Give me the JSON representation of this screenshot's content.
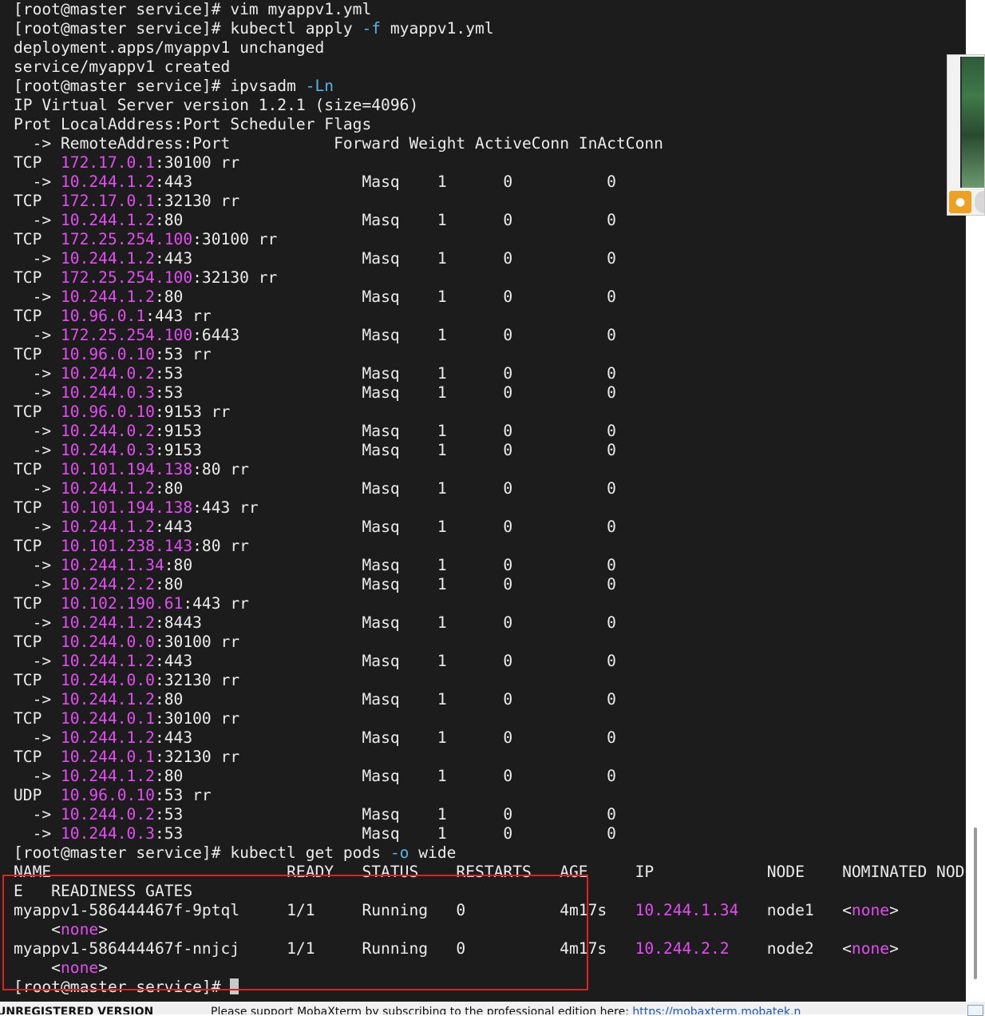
{
  "terminal": {
    "colors": {
      "background": "#1c1c1c",
      "text": "#ececec",
      "ip": "#e34df2",
      "flag": "#56b6e6",
      "highlight_box": "#dd2222"
    },
    "lines": [
      [
        {
          "t": "[root@master service]# vim myappv1.yml",
          "c": "n"
        }
      ],
      [
        {
          "t": "[root@master service]# kubectl apply ",
          "c": "n"
        },
        {
          "t": "-f",
          "c": "c"
        },
        {
          "t": " myappv1.yml",
          "c": "n"
        }
      ],
      [
        {
          "t": "deployment.apps/myappv1 unchanged",
          "c": "n"
        }
      ],
      [
        {
          "t": "service/myappv1 created",
          "c": "n"
        }
      ],
      [
        {
          "t": "[root@master service]# ipvsadm ",
          "c": "n"
        },
        {
          "t": "-Ln",
          "c": "c"
        }
      ],
      [
        {
          "t": "IP Virtual Server version 1.2.1 (size=4096)",
          "c": "n"
        }
      ],
      [
        {
          "t": "Prot LocalAddress:Port Scheduler Flags",
          "c": "n"
        }
      ],
      [
        {
          "t": "  -> RemoteAddress:Port           Forward Weight ActiveConn InActConn",
          "c": "n"
        }
      ],
      [
        {
          "t": "TCP  ",
          "c": "n"
        },
        {
          "t": "172.17.0.1",
          "c": "m"
        },
        {
          "t": ":30100 rr",
          "c": "n"
        }
      ],
      [
        {
          "t": "  -> ",
          "c": "n"
        },
        {
          "t": "10.244.1.2",
          "c": "m"
        },
        {
          "t": ":443                  Masq    1      0          0",
          "c": "n"
        }
      ],
      [
        {
          "t": "TCP  ",
          "c": "n"
        },
        {
          "t": "172.17.0.1",
          "c": "m"
        },
        {
          "t": ":32130 rr",
          "c": "n"
        }
      ],
      [
        {
          "t": "  -> ",
          "c": "n"
        },
        {
          "t": "10.244.1.2",
          "c": "m"
        },
        {
          "t": ":80                   Masq    1      0          0",
          "c": "n"
        }
      ],
      [
        {
          "t": "TCP  ",
          "c": "n"
        },
        {
          "t": "172.25.254.100",
          "c": "m"
        },
        {
          "t": ":30100 rr",
          "c": "n"
        }
      ],
      [
        {
          "t": "  -> ",
          "c": "n"
        },
        {
          "t": "10.244.1.2",
          "c": "m"
        },
        {
          "t": ":443                  Masq    1      0          0",
          "c": "n"
        }
      ],
      [
        {
          "t": "TCP  ",
          "c": "n"
        },
        {
          "t": "172.25.254.100",
          "c": "m"
        },
        {
          "t": ":32130 rr",
          "c": "n"
        }
      ],
      [
        {
          "t": "  -> ",
          "c": "n"
        },
        {
          "t": "10.244.1.2",
          "c": "m"
        },
        {
          "t": ":80                   Masq    1      0          0",
          "c": "n"
        }
      ],
      [
        {
          "t": "TCP  ",
          "c": "n"
        },
        {
          "t": "10.96.0.1",
          "c": "m"
        },
        {
          "t": ":443 rr",
          "c": "n"
        }
      ],
      [
        {
          "t": "  -> ",
          "c": "n"
        },
        {
          "t": "172.25.254.100",
          "c": "m"
        },
        {
          "t": ":6443             Masq    1      0          0",
          "c": "n"
        }
      ],
      [
        {
          "t": "TCP  ",
          "c": "n"
        },
        {
          "t": "10.96.0.10",
          "c": "m"
        },
        {
          "t": ":53 rr",
          "c": "n"
        }
      ],
      [
        {
          "t": "  -> ",
          "c": "n"
        },
        {
          "t": "10.244.0.2",
          "c": "m"
        },
        {
          "t": ":53                   Masq    1      0          0",
          "c": "n"
        }
      ],
      [
        {
          "t": "  -> ",
          "c": "n"
        },
        {
          "t": "10.244.0.3",
          "c": "m"
        },
        {
          "t": ":53                   Masq    1      0          0",
          "c": "n"
        }
      ],
      [
        {
          "t": "TCP  ",
          "c": "n"
        },
        {
          "t": "10.96.0.10",
          "c": "m"
        },
        {
          "t": ":9153 rr",
          "c": "n"
        }
      ],
      [
        {
          "t": "  -> ",
          "c": "n"
        },
        {
          "t": "10.244.0.2",
          "c": "m"
        },
        {
          "t": ":9153                 Masq    1      0          0",
          "c": "n"
        }
      ],
      [
        {
          "t": "  -> ",
          "c": "n"
        },
        {
          "t": "10.244.0.3",
          "c": "m"
        },
        {
          "t": ":9153                 Masq    1      0          0",
          "c": "n"
        }
      ],
      [
        {
          "t": "TCP  ",
          "c": "n"
        },
        {
          "t": "10.101.194.138",
          "c": "m"
        },
        {
          "t": ":80 rr",
          "c": "n"
        }
      ],
      [
        {
          "t": "  -> ",
          "c": "n"
        },
        {
          "t": "10.244.1.2",
          "c": "m"
        },
        {
          "t": ":80                   Masq    1      0          0",
          "c": "n"
        }
      ],
      [
        {
          "t": "TCP  ",
          "c": "n"
        },
        {
          "t": "10.101.194.138",
          "c": "m"
        },
        {
          "t": ":443 rr",
          "c": "n"
        }
      ],
      [
        {
          "t": "  -> ",
          "c": "n"
        },
        {
          "t": "10.244.1.2",
          "c": "m"
        },
        {
          "t": ":443                  Masq    1      0          0",
          "c": "n"
        }
      ],
      [
        {
          "t": "TCP  ",
          "c": "n"
        },
        {
          "t": "10.101.238.143",
          "c": "m"
        },
        {
          "t": ":80 rr",
          "c": "n"
        }
      ],
      [
        {
          "t": "  -> ",
          "c": "n"
        },
        {
          "t": "10.244.1.34",
          "c": "m"
        },
        {
          "t": ":80                  Masq    1      0          0",
          "c": "n"
        }
      ],
      [
        {
          "t": "  -> ",
          "c": "n"
        },
        {
          "t": "10.244.2.2",
          "c": "m"
        },
        {
          "t": ":80                   Masq    1      0          0",
          "c": "n"
        }
      ],
      [
        {
          "t": "TCP  ",
          "c": "n"
        },
        {
          "t": "10.102.190.61",
          "c": "m"
        },
        {
          "t": ":443 rr",
          "c": "n"
        }
      ],
      [
        {
          "t": "  -> ",
          "c": "n"
        },
        {
          "t": "10.244.1.2",
          "c": "m"
        },
        {
          "t": ":8443                 Masq    1      0          0",
          "c": "n"
        }
      ],
      [
        {
          "t": "TCP  ",
          "c": "n"
        },
        {
          "t": "10.244.0.0",
          "c": "m"
        },
        {
          "t": ":30100 rr",
          "c": "n"
        }
      ],
      [
        {
          "t": "  -> ",
          "c": "n"
        },
        {
          "t": "10.244.1.2",
          "c": "m"
        },
        {
          "t": ":443                  Masq    1      0          0",
          "c": "n"
        }
      ],
      [
        {
          "t": "TCP  ",
          "c": "n"
        },
        {
          "t": "10.244.0.0",
          "c": "m"
        },
        {
          "t": ":32130 rr",
          "c": "n"
        }
      ],
      [
        {
          "t": "  -> ",
          "c": "n"
        },
        {
          "t": "10.244.1.2",
          "c": "m"
        },
        {
          "t": ":80                   Masq    1      0          0",
          "c": "n"
        }
      ],
      [
        {
          "t": "TCP  ",
          "c": "n"
        },
        {
          "t": "10.244.0.1",
          "c": "m"
        },
        {
          "t": ":30100 rr",
          "c": "n"
        }
      ],
      [
        {
          "t": "  -> ",
          "c": "n"
        },
        {
          "t": "10.244.1.2",
          "c": "m"
        },
        {
          "t": ":443                  Masq    1      0          0",
          "c": "n"
        }
      ],
      [
        {
          "t": "TCP  ",
          "c": "n"
        },
        {
          "t": "10.244.0.1",
          "c": "m"
        },
        {
          "t": ":32130 rr",
          "c": "n"
        }
      ],
      [
        {
          "t": "  -> ",
          "c": "n"
        },
        {
          "t": "10.244.1.2",
          "c": "m"
        },
        {
          "t": ":80                   Masq    1      0          0",
          "c": "n"
        }
      ],
      [
        {
          "t": "UDP  ",
          "c": "n"
        },
        {
          "t": "10.96.0.10",
          "c": "m"
        },
        {
          "t": ":53 rr",
          "c": "n"
        }
      ],
      [
        {
          "t": "  -> ",
          "c": "n"
        },
        {
          "t": "10.244.0.2",
          "c": "m"
        },
        {
          "t": ":53                   Masq    1      0          0",
          "c": "n"
        }
      ],
      [
        {
          "t": "  -> ",
          "c": "n"
        },
        {
          "t": "10.244.0.3",
          "c": "m"
        },
        {
          "t": ":53                   Masq    1      0          0",
          "c": "n"
        }
      ],
      [
        {
          "t": "[root@master service]# kubectl get pods ",
          "c": "n"
        },
        {
          "t": "-o",
          "c": "c"
        },
        {
          "t": " wide",
          "c": "n"
        }
      ],
      [
        {
          "t": "NAME                         READY   STATUS    RESTARTS   AGE     IP            NODE    NOMINATED NOD",
          "c": "n"
        }
      ],
      [
        {
          "t": "E   READINESS GATES",
          "c": "n"
        }
      ],
      [
        {
          "t": "myappv1-586444467f-9ptql     1/1     Running   0          4m17s   ",
          "c": "n"
        },
        {
          "t": "10.244.1.34",
          "c": "m"
        },
        {
          "t": "   node1   <",
          "c": "n"
        },
        {
          "t": "none",
          "c": "m"
        },
        {
          "t": ">",
          "c": "n"
        }
      ],
      [
        {
          "t": "    <",
          "c": "n"
        },
        {
          "t": "none",
          "c": "m"
        },
        {
          "t": ">",
          "c": "n"
        }
      ],
      [
        {
          "t": "myappv1-586444467f-nnjcj     1/1     Running   0          4m17s   ",
          "c": "n"
        },
        {
          "t": "10.244.2.2",
          "c": "m"
        },
        {
          "t": "    node2   <",
          "c": "n"
        },
        {
          "t": "none",
          "c": "m"
        },
        {
          "t": ">",
          "c": "n"
        }
      ],
      [
        {
          "t": "    <",
          "c": "n"
        },
        {
          "t": "none",
          "c": "m"
        },
        {
          "t": ">",
          "c": "n"
        }
      ],
      [
        {
          "t": "[root@master service]# ",
          "c": "n"
        }
      ]
    ]
  },
  "status_bar": {
    "unregistered": "UNREGISTERED VERSION",
    "message": "Please support MobaXterm by subscribing to the professional edition here:",
    "link": "https://mobaxterm.mobatek.n"
  },
  "side_panel": {
    "icon": "user-icon"
  }
}
